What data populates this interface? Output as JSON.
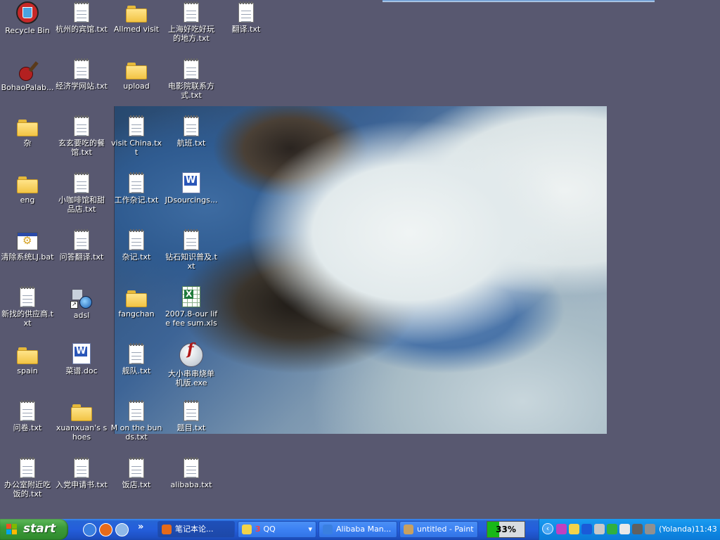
{
  "desktop": {
    "icons": [
      {
        "label": "Recycle Bin",
        "icon": "recycle-bin-icon",
        "name": "desktop-icon-recycle-bin"
      },
      {
        "label": "BohaoPalab...",
        "icon": "guitar-icon",
        "name": "desktop-icon-bohaopalab"
      },
      {
        "label": "杂",
        "icon": "folder-icon",
        "name": "desktop-icon-za"
      },
      {
        "label": "eng",
        "icon": "folder-icon",
        "name": "desktop-icon-eng"
      },
      {
        "label": "清除系统LJ.bat",
        "icon": "batch-file-icon",
        "name": "desktop-icon-clean-bat"
      },
      {
        "label": "新找的供应商.txt",
        "icon": "text-file-icon",
        "name": "desktop-icon-new-supplier-txt"
      },
      {
        "label": "spain",
        "icon": "folder-icon",
        "name": "desktop-icon-spain"
      },
      {
        "label": "问卷.txt",
        "icon": "text-file-icon",
        "name": "desktop-icon-questionnaire-txt"
      },
      {
        "label": "办公室附近吃饭的.txt",
        "icon": "text-file-icon",
        "name": "desktop-icon-office-food-txt"
      },
      {
        "label": "杭州的宾馆.txt",
        "icon": "text-file-icon",
        "name": "desktop-icon-hangzhou-hotel-txt"
      },
      {
        "label": "经济学网站.txt",
        "icon": "text-file-icon",
        "name": "desktop-icon-economics-sites-txt"
      },
      {
        "label": "玄玄要吃的餐馆.txt",
        "icon": "text-file-icon",
        "name": "desktop-icon-restaurants-txt"
      },
      {
        "label": "小咖啡馆和甜品店.txt",
        "icon": "text-file-icon",
        "name": "desktop-icon-cafes-txt"
      },
      {
        "label": "问答翻译.txt",
        "icon": "text-file-icon",
        "name": "desktop-icon-qa-translation-txt"
      },
      {
        "label": "adsl",
        "icon": "network-connection-icon",
        "name": "desktop-icon-adsl"
      },
      {
        "label": "菜谱.doc",
        "icon": "word-document-icon",
        "name": "desktop-icon-recipes-doc"
      },
      {
        "label": "xuanxuan's shoes",
        "icon": "folder-icon",
        "name": "desktop-icon-xuanxuan-shoes"
      },
      {
        "label": "入党申请书.txt",
        "icon": "text-file-icon",
        "name": "desktop-icon-party-application-txt"
      },
      {
        "label": "Allmed visit",
        "icon": "folder-icon",
        "name": "desktop-icon-allmed-visit"
      },
      {
        "label": "upload",
        "icon": "folder-icon",
        "name": "desktop-icon-upload"
      },
      {
        "label": "visit China.txt",
        "icon": "text-file-icon",
        "name": "desktop-icon-visit-china-txt"
      },
      {
        "label": "工作杂记.txt",
        "icon": "text-file-icon",
        "name": "desktop-icon-work-notes-txt"
      },
      {
        "label": "杂记.txt",
        "icon": "text-file-icon",
        "name": "desktop-icon-notes-txt"
      },
      {
        "label": "fangchan",
        "icon": "folder-icon",
        "name": "desktop-icon-fangchan"
      },
      {
        "label": "舰队.txt",
        "icon": "text-file-icon",
        "name": "desktop-icon-fleet-txt"
      },
      {
        "label": "M on the bunds.txt",
        "icon": "text-file-icon",
        "name": "desktop-icon-m-on-the-bunds-txt"
      },
      {
        "label": "饭店.txt",
        "icon": "text-file-icon",
        "name": "desktop-icon-restaurant-txt"
      },
      {
        "label": "上海好吃好玩的地方.txt",
        "icon": "text-file-icon",
        "name": "desktop-icon-shanghai-places-txt"
      },
      {
        "label": "电影院联系方式.txt",
        "icon": "text-file-icon",
        "name": "desktop-icon-cinema-contacts-txt"
      },
      {
        "label": "航班.txt",
        "icon": "text-file-icon",
        "name": "desktop-icon-flights-txt"
      },
      {
        "label": "JDsourcings...",
        "icon": "word-document-icon",
        "name": "desktop-icon-jdsourcings"
      },
      {
        "label": "钻石知识普及.txt",
        "icon": "text-file-icon",
        "name": "desktop-icon-diamond-knowledge-txt"
      },
      {
        "label": "2007.8-our life fee sum.xls",
        "icon": "excel-spreadsheet-icon",
        "name": "desktop-icon-life-fee-xls"
      },
      {
        "label": "大小串串烧单机版.exe",
        "icon": "flash-player-icon",
        "name": "desktop-icon-flash-exe"
      },
      {
        "label": "题目.txt",
        "icon": "text-file-icon",
        "name": "desktop-icon-topic-txt"
      },
      {
        "label": "alibaba.txt",
        "icon": "text-file-icon",
        "name": "desktop-icon-alibaba-txt"
      },
      {
        "label": "翻译.txt",
        "icon": "text-file-icon",
        "name": "desktop-icon-translation-txt"
      }
    ]
  },
  "taskbar": {
    "start_label": "start",
    "quick_launch": [
      {
        "icon": "internet-explorer-icon",
        "color": "#3a7fe0"
      },
      {
        "icon": "firefox-icon",
        "color": "#e66a1a"
      },
      {
        "icon": "show-desktop-icon",
        "color": "#8fb8e8"
      }
    ],
    "overflow_label": "»",
    "tasks": [
      {
        "label": "笔记本论...",
        "icon": "firefox-icon",
        "color": "#e66a1a",
        "name": "task-notebook-forum"
      },
      {
        "label": "QQ",
        "count": "3",
        "icon": "qq-icon",
        "color": "#f2d34a",
        "name": "task-qq"
      },
      {
        "label": "Alibaba Man...",
        "icon": "internet-explorer-icon",
        "color": "#3a7fe0",
        "name": "task-alibaba-manager"
      },
      {
        "label": "untitled - Paint",
        "icon": "paint-icon",
        "color": "#c8a060",
        "name": "task-paint"
      }
    ],
    "progress": {
      "label": "33%",
      "value": 33,
      "color": "#18b818"
    },
    "tray": {
      "toggle_label": "‹",
      "icons": [
        {
          "icon": "p-app-icon",
          "color": "#c040c0"
        },
        {
          "icon": "qq-tray-icon",
          "color": "#f2d34a"
        },
        {
          "icon": "b-app-icon",
          "color": "#1a5ad8"
        },
        {
          "icon": "network-tray-icon",
          "color": "#c8c8c8"
        },
        {
          "icon": "messenger-icon",
          "color": "#30b040"
        },
        {
          "icon": "mouse-icon",
          "color": "#e8e8e8"
        },
        {
          "icon": "printer-icon",
          "color": "#606060"
        },
        {
          "icon": "speaker-icon",
          "color": "#909090"
        }
      ],
      "clock": "(Yolanda)11:43"
    }
  }
}
